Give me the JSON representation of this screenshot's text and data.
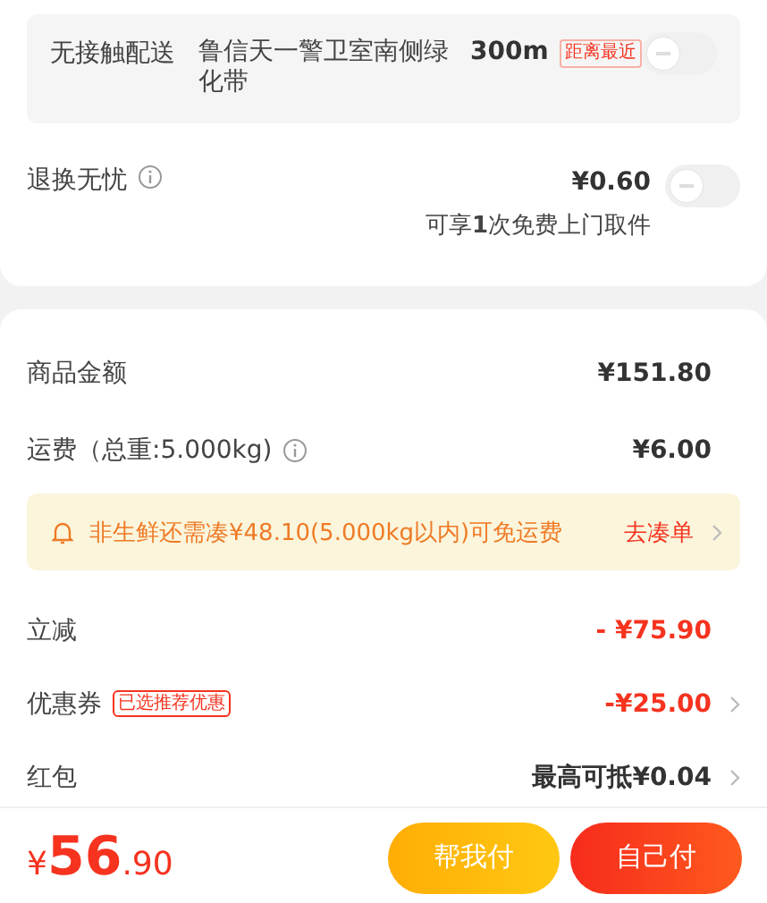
{
  "delivery": {
    "label": "无接触配送",
    "address": "鲁信天一警卫室南侧绿化带",
    "distance": "300m",
    "tag": "距离最近",
    "on": false
  },
  "return_service": {
    "label": "退换无忧",
    "price": "¥0.60",
    "note": "可享**1**次免费上门取件",
    "on": false
  },
  "fees": [
    {
      "kind": "plain",
      "label": "商品金额",
      "value": "¥151.80"
    },
    {
      "kind": "info",
      "label": "运费（总重:5.000kg)",
      "value": "¥6.00"
    }
  ],
  "notice": {
    "text": "非生鲜还需凑¥48.10(5.000kg以内)可免运费",
    "action": "去凑单"
  },
  "discounts": [
    {
      "kind": "discount",
      "label": "立减",
      "value": "- ¥75.90",
      "arrow": false
    },
    {
      "kind": "discount",
      "label": "优惠券",
      "tag": "已选推荐优惠",
      "value": "-¥25.00",
      "arrow": true
    },
    {
      "kind": "amount",
      "label": "红包",
      "value": "最高可抵¥0.04",
      "arrow": true
    }
  ],
  "total": {
    "currency": "¥",
    "integer": "56",
    "decimal": ".90"
  },
  "buttons": [
    {
      "kind": "secondary",
      "label": "帮我付"
    },
    {
      "kind": "primary",
      "label": "自己付"
    }
  ]
}
